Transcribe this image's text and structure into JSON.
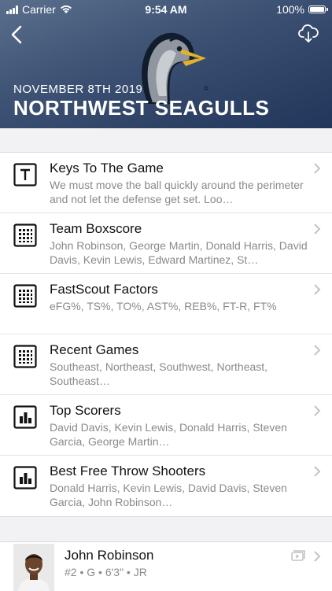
{
  "status_bar": {
    "carrier": "Carrier",
    "time": "9:54 AM",
    "battery": "100%"
  },
  "header": {
    "date": "NOVEMBER 8TH 2019",
    "team": "NORTHWEST SEAGULLS"
  },
  "colors": {
    "header_dark": "#22355a",
    "header_light": "#5a6f8c",
    "subtitle": "#8a8a8e"
  },
  "list": [
    {
      "title": "Keys To The Game",
      "subtitle": "We must move the ball quickly around the perimeter and not let the defense get set. Loo…",
      "icon": "text-box-icon"
    },
    {
      "title": "Team Boxscore",
      "subtitle": "John Robinson, George Martin, Donald Harris, David Davis, Kevin Lewis, Edward Martinez, St…",
      "icon": "grid-icon"
    },
    {
      "title": "FastScout Factors",
      "subtitle": "eFG%, TS%, TO%, AST%, REB%, FT-R, FT%",
      "icon": "grid-icon"
    },
    {
      "title": "Recent Games",
      "subtitle": "Southeast, Northeast, Southwest, Northeast, Southeast…",
      "icon": "grid-icon"
    },
    {
      "title": "Top Scorers",
      "subtitle": "David Davis, Kevin Lewis, Donald Harris, Steven Garcia, George Martin…",
      "icon": "bar-chart-icon"
    },
    {
      "title": "Best Free Throw Shooters",
      "subtitle": "Donald Harris, Kevin Lewis, David Davis, Steven Garcia, John Robinson…",
      "icon": "bar-chart-icon"
    }
  ],
  "player": {
    "name": "John Robinson",
    "info": "#2 • G • 6'3\" • JR"
  }
}
